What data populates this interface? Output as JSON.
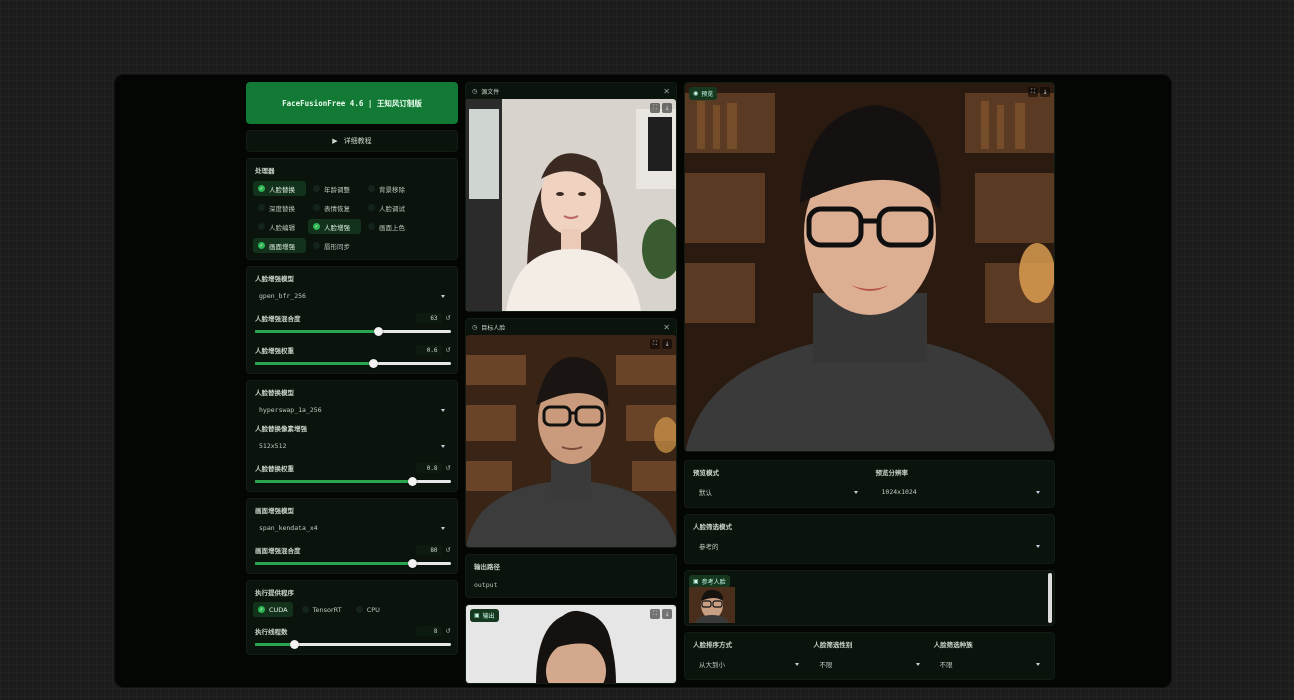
{
  "app": {
    "title": "FaceFusionFree 4.6 | 王知风订制版"
  },
  "tutorial": {
    "label": "详细教程"
  },
  "processors": {
    "label": "处理器",
    "items": [
      {
        "label": "人脸替换",
        "checked": true
      },
      {
        "label": "年龄调整",
        "checked": false
      },
      {
        "label": "背景移除",
        "checked": false
      },
      {
        "label": "深度替换",
        "checked": false
      },
      {
        "label": "表情恢复",
        "checked": false
      },
      {
        "label": "人脸调试",
        "checked": false
      },
      {
        "label": "人脸编辑",
        "checked": false
      },
      {
        "label": "人脸增强",
        "checked": true
      },
      {
        "label": "画面上色",
        "checked": false
      },
      {
        "label": "画面增强",
        "checked": true
      },
      {
        "label": "唇形同步",
        "checked": false
      }
    ]
  },
  "face_enhancer": {
    "model_label": "人脸增强模型",
    "model_value": "gpen_bfr_256",
    "blend_label": "人脸增强混合度",
    "blend_value": "63",
    "blend_fraction": 0.63,
    "weight_label": "人脸增强权重",
    "weight_value": "0.6",
    "weight_fraction": 0.6
  },
  "face_swapper": {
    "model_label": "人脸替换模型",
    "model_value": "hyperswap_1a_256",
    "pixel_label": "人脸替换像素增强",
    "pixel_value": "512x512",
    "weight_label": "人脸替换权重",
    "weight_value": "0.8",
    "weight_fraction": 0.8
  },
  "frame_enhancer": {
    "model_label": "画面增强模型",
    "model_value": "span_kendata_x4",
    "blend_label": "画面增强混合度",
    "blend_value": "80",
    "blend_fraction": 0.8
  },
  "execution": {
    "providers_label": "执行提供程序",
    "providers": [
      {
        "label": "CUDA",
        "checked": true
      },
      {
        "label": "TensorRT",
        "checked": false
      },
      {
        "label": "CPU",
        "checked": false
      }
    ],
    "threads_label": "执行线程数",
    "threads_value": "8",
    "threads_fraction": 0.2
  },
  "source": {
    "label": "源文件"
  },
  "target": {
    "label": "目标人脸"
  },
  "output_path": {
    "label": "输出路径",
    "value": "output"
  },
  "output": {
    "label": "输出"
  },
  "preview": {
    "label": "预览",
    "mode_label": "预览模式",
    "mode_value": "默认",
    "resolution_label": "预览分辨率",
    "resolution_value": "1024x1024"
  },
  "face_selector": {
    "label": "人脸筛选模式",
    "value": "参考的"
  },
  "reference": {
    "label": "参考人脸"
  },
  "face_sort": {
    "order_label": "人脸排序方式",
    "order_value": "从大到小",
    "gender_label": "人脸筛选性别",
    "gender_value": "不限",
    "race_label": "人脸筛选种族",
    "race_value": "不限"
  },
  "colors": {
    "accent": "#2aa64e",
    "title_bg": "#137a36",
    "card_bg": "#0a130c"
  }
}
